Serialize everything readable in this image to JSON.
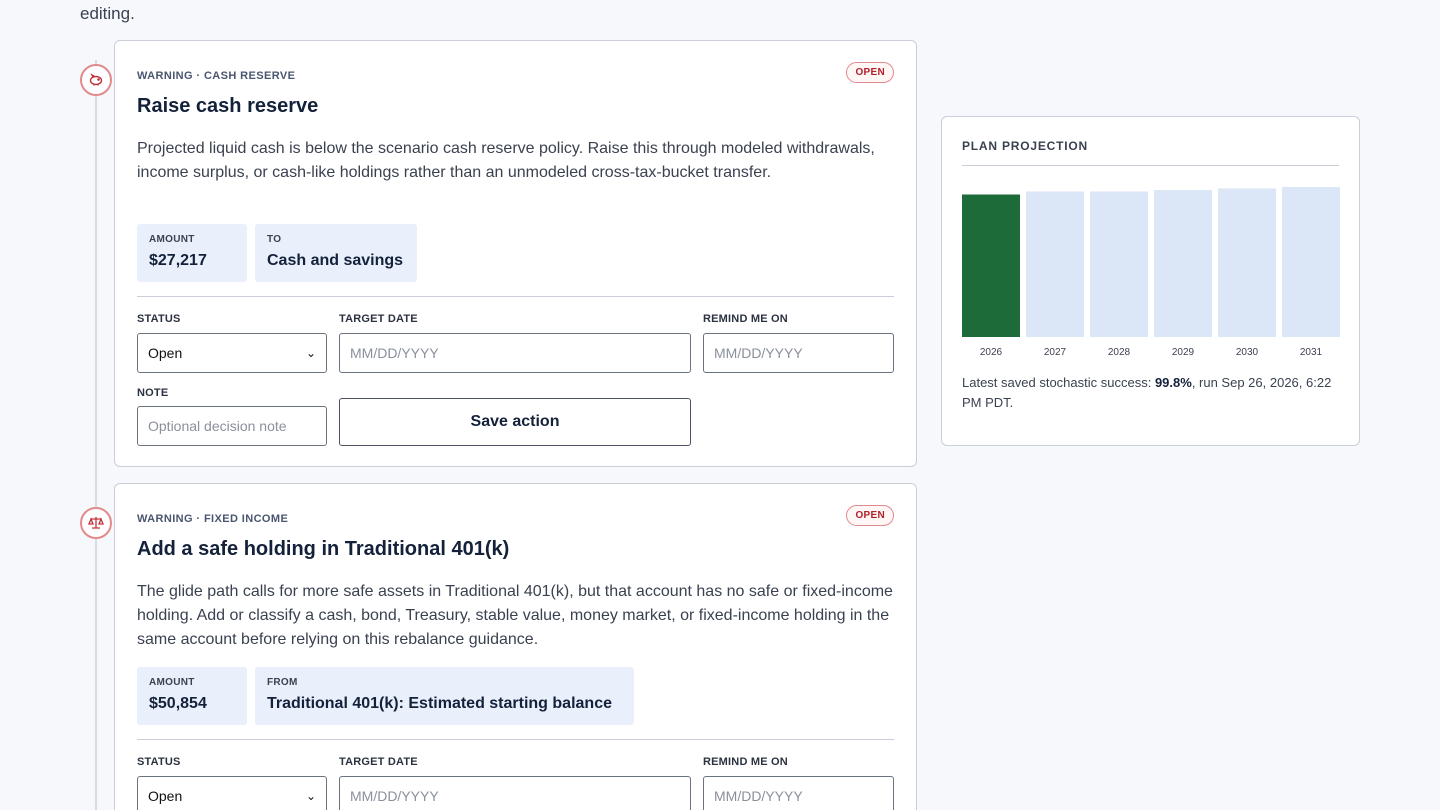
{
  "intro_text": "editing.",
  "colors": {
    "accent_red": "#b0212a",
    "bar_current": "#1e6b3a",
    "bar_future": "#dbe6f6"
  },
  "actions": [
    {
      "icon": "piggy-bank-icon",
      "kicker": "WARNING · CASH RESERVE",
      "status_badge": "OPEN",
      "title": "Raise cash reserve",
      "description": "Projected liquid cash is below the scenario cash reserve policy. Raise this through modeled withdrawals, income surplus, or cash-like holdings rather than an unmodeled cross-tax-bucket transfer.",
      "amount_label": "AMOUNT",
      "amount": "$27,217",
      "target_label": "TO",
      "target": "Cash and savings",
      "status_label": "STATUS",
      "status_value": "Open",
      "target_date_label": "TARGET DATE",
      "target_date_placeholder": "MM/DD/YYYY",
      "remind_label": "REMIND ME ON",
      "remind_placeholder": "MM/DD/YYYY",
      "note_label": "NOTE",
      "note_placeholder": "Optional decision note",
      "save_label": "Save action"
    },
    {
      "icon": "scale-icon",
      "kicker": "WARNING · FIXED INCOME",
      "status_badge": "OPEN",
      "title": "Add a safe holding in Traditional 401(k)",
      "description": "The glide path calls for more safe assets in Traditional 401(k), but that account has no safe or fixed-income holding. Add or classify a cash, bond, Treasury, stable value, money market, or fixed-income holding in the same account before relying on this rebalance guidance.",
      "amount_label": "AMOUNT",
      "amount": "$50,854",
      "target_label": "FROM",
      "target": "Traditional 401(k): Estimated starting balance",
      "status_label": "STATUS",
      "status_value": "Open",
      "target_date_label": "TARGET DATE",
      "target_date_placeholder": "MM/DD/YYYY",
      "remind_label": "REMIND ME ON",
      "remind_placeholder": "MM/DD/YYYY"
    }
  ],
  "projection": {
    "title": "PLAN PROJECTION",
    "note_prefix": "Latest saved stochastic success: ",
    "note_value": "99.8%",
    "note_suffix": ", run Sep 26, 2026, 6:22 PM PDT."
  },
  "chart_data": {
    "type": "bar",
    "categories": [
      "2026",
      "2027",
      "2028",
      "2029",
      "2030",
      "2031"
    ],
    "values": [
      0.95,
      0.97,
      0.97,
      0.98,
      0.99,
      1.0
    ],
    "highlight_index": 0,
    "ylim": [
      0,
      1
    ],
    "grid": false
  }
}
